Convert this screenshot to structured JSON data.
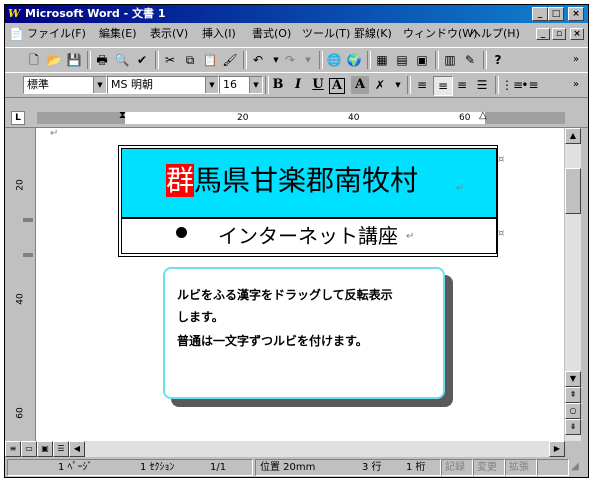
{
  "window": {
    "title": "Microsoft Word - 文書 1",
    "buttons": {
      "minimize": "_",
      "maximize": "□",
      "close": "×"
    },
    "doc_buttons": {
      "minimize": "_",
      "restore": "▫",
      "close": "×"
    }
  },
  "menu": {
    "items": [
      "ファイル(F)",
      "編集(E)",
      "表示(V)",
      "挿入(I)",
      "書式(O)",
      "ツール(T)",
      "罫線(K)",
      "ウィンドウ(W)",
      "ヘルプ(H)"
    ]
  },
  "toolbar": {
    "more": "»"
  },
  "format": {
    "style": "標準",
    "font": "MS 明朝",
    "size": "16",
    "bold": "B",
    "italic": "I",
    "underline": "U",
    "border_char": "A",
    "shade_char": "A"
  },
  "ruler": {
    "tab_selector": "L",
    "numbers": [
      "20",
      "40",
      "60"
    ],
    "vertical_numbers": [
      "20",
      "40",
      "60"
    ]
  },
  "document": {
    "row1_selected": "群",
    "row1_rest": "馬県甘楽郡南牧村",
    "row2_text": "インターネット講座",
    "para_mark": "↵",
    "cell_mark": "¤"
  },
  "callout": {
    "line1": "ルビをふる漢字をドラッグして反転表示",
    "line2": "します。",
    "line3": "普通は一文字ずつルビを付けます。"
  },
  "status": {
    "page": "1 ﾍﾟｰｼﾞ",
    "section": "1 ｾｸｼｮﾝ",
    "page_of": "1/1",
    "position": "位置 20mm",
    "line": "3 行",
    "column": "1 桁",
    "rec": "記録",
    "trk": "変更",
    "ext": "拡張"
  },
  "colors": {
    "title_bar": "#000080",
    "cell_fill": "#00e0ff",
    "selection": "#ff0000",
    "callout_border": "#6de0ee"
  }
}
